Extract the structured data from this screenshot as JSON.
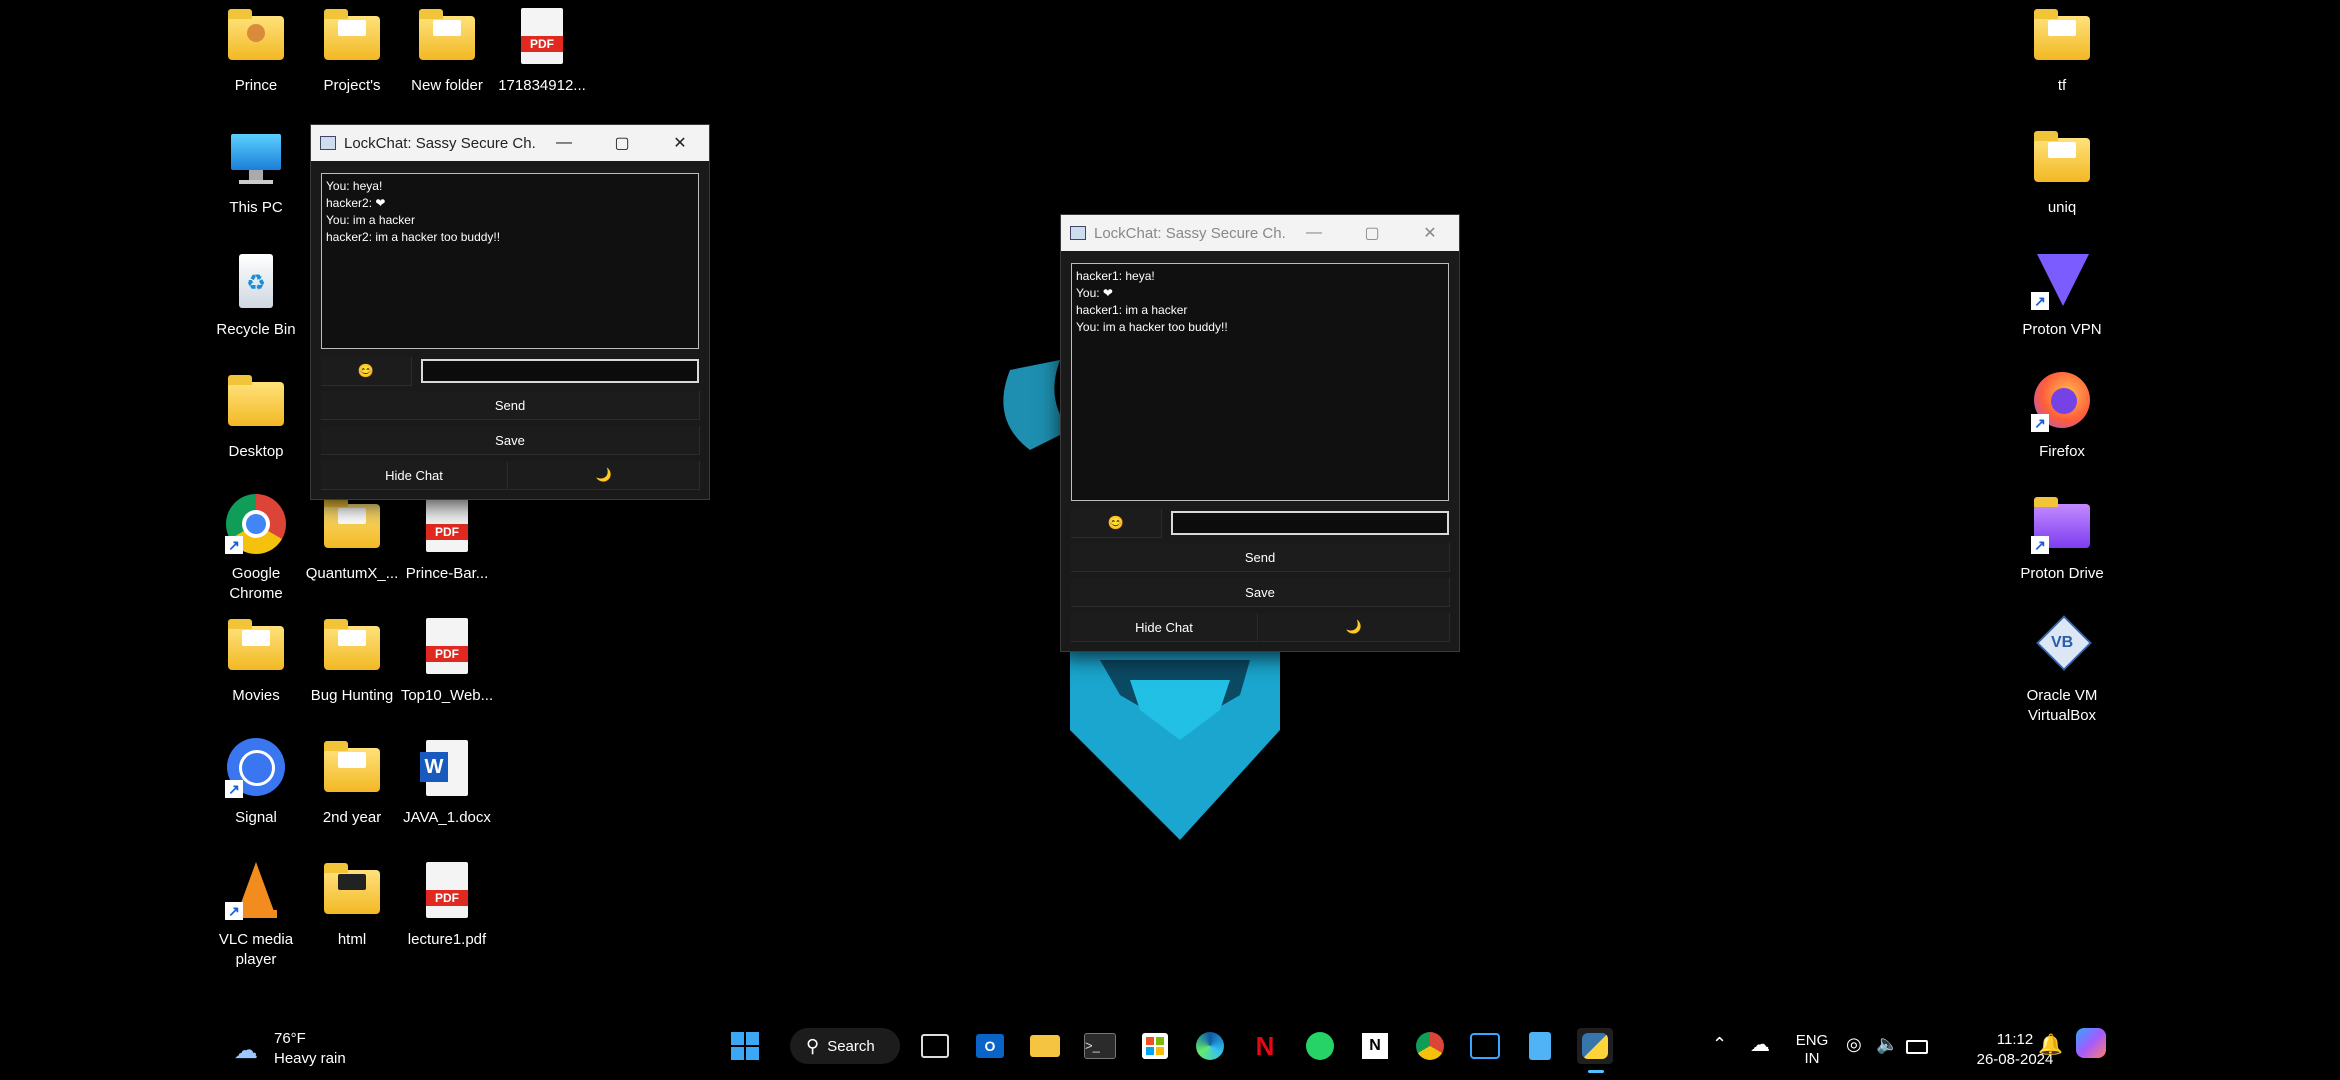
{
  "desktop_icons": [
    {
      "label": "Prince",
      "icon": "user-folder-icon"
    },
    {
      "label": "Project's",
      "icon": "folder-icon"
    },
    {
      "label": "New folder",
      "icon": "folder-icon"
    },
    {
      "label": "171834912...",
      "icon": "pdf-icon"
    },
    {
      "label": "This PC",
      "icon": "computer-icon"
    },
    {
      "label": "Recycle Bin",
      "icon": "recycle-bin-icon"
    },
    {
      "label": "Desktop",
      "icon": "folder-icon"
    },
    {
      "label": "Google Chrome",
      "icon": "chrome-icon"
    },
    {
      "label": "QuantumX_...",
      "icon": "folder-icon"
    },
    {
      "label": "Prince-Bar...",
      "icon": "pdf-icon"
    },
    {
      "label": "Movies",
      "icon": "folder-icon"
    },
    {
      "label": "Bug Hunting",
      "icon": "folder-icon"
    },
    {
      "label": "Top10_Web...",
      "icon": "pdf-icon"
    },
    {
      "label": "Signal",
      "icon": "signal-icon"
    },
    {
      "label": "2nd year",
      "icon": "folder-icon"
    },
    {
      "label": "JAVA_1.docx",
      "icon": "word-doc-icon"
    },
    {
      "label": "VLC media player",
      "icon": "vlc-icon"
    },
    {
      "label": "html",
      "icon": "folder-icon"
    },
    {
      "label": "lecture1.pdf",
      "icon": "pdf-icon"
    },
    {
      "label": "tf",
      "icon": "folder-icon"
    },
    {
      "label": "uniq",
      "icon": "folder-icon"
    },
    {
      "label": "Proton VPN",
      "icon": "proton-vpn-icon"
    },
    {
      "label": "Firefox",
      "icon": "firefox-icon"
    },
    {
      "label": "Proton Drive",
      "icon": "proton-drive-icon"
    },
    {
      "label": "Oracle VM VirtualBox",
      "icon": "virtualbox-icon"
    }
  ],
  "windows": [
    {
      "title": "LockChat: Sassy Secure Ch...",
      "messages": [
        "You: heya!",
        "hacker2: ❤",
        "You: im a hacker",
        "hacker2: im a hacker too buddy!!"
      ],
      "emoji_button": "😊",
      "send": "Send",
      "save": "Save",
      "hide_chat": "Hide Chat",
      "theme_toggle": "🌙",
      "minimize": "—",
      "maximize": "▢",
      "close": "✕"
    },
    {
      "title": "LockChat: Sassy Secure Ch...",
      "messages": [
        "hacker1: heya!",
        "You: ❤",
        "hacker1: im a hacker",
        "You: im a hacker too buddy!!"
      ],
      "emoji_button": "😊",
      "send": "Send",
      "save": "Save",
      "hide_chat": "Hide Chat",
      "theme_toggle": "🌙",
      "minimize": "—",
      "maximize": "▢",
      "close": "✕"
    }
  ],
  "taskbar": {
    "weather_temp": "76°F",
    "weather_desc": "Heavy rain",
    "search_label": "Search",
    "lang_top": "ENG",
    "lang_bottom": "IN",
    "time": "11:12",
    "date": "26-08-2024"
  }
}
